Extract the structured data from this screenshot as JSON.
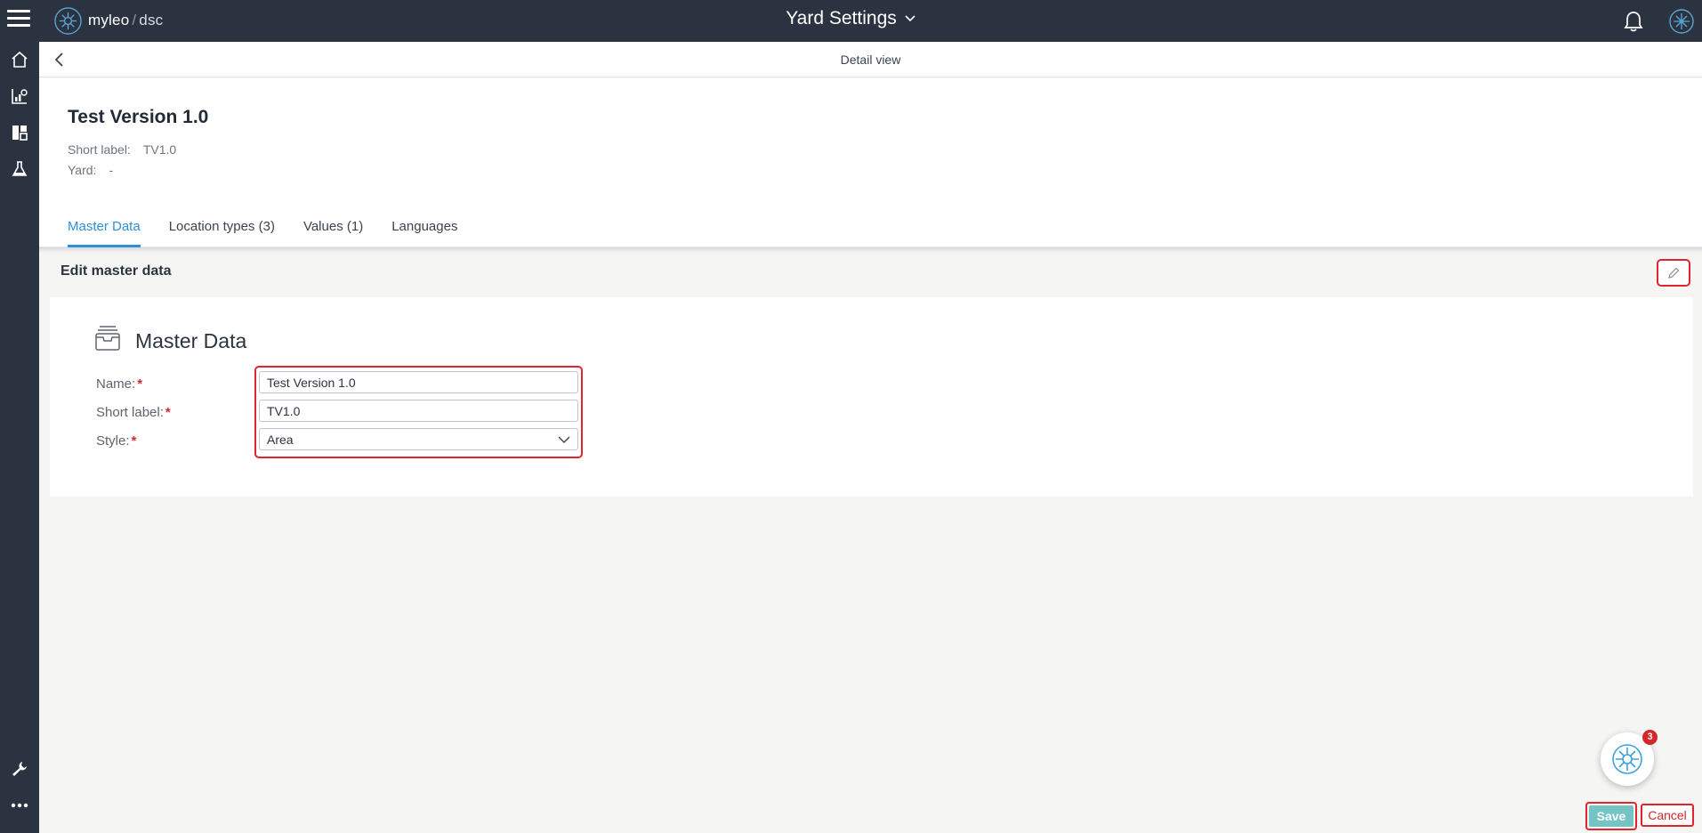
{
  "topbar": {
    "brand": "myleo",
    "brand_sep": "/",
    "brand_product": "dsc",
    "app_title": "Yard Settings",
    "icons": [
      "menu-icon",
      "logo-icon",
      "chevron-down-icon",
      "bell-icon",
      "user-avatar-icon"
    ]
  },
  "sidebar": {
    "items": [
      {
        "name": "home",
        "icon": "home-icon"
      },
      {
        "name": "analytics",
        "icon": "chart-icon"
      },
      {
        "name": "dashboard",
        "icon": "dashboard-icon"
      },
      {
        "name": "lab",
        "icon": "flask-icon"
      },
      {
        "name": "tools",
        "icon": "wrench-icon"
      },
      {
        "name": "more",
        "icon": "more-icon"
      }
    ]
  },
  "subheader": {
    "title": "Detail view"
  },
  "record": {
    "title": "Test Version 1.0",
    "short_label_key": "Short label:",
    "short_label_value": "TV1.0",
    "yard_key": "Yard:",
    "yard_value": "-"
  },
  "tabs": [
    {
      "label": "Master Data",
      "active": true
    },
    {
      "label": "Location types (3)",
      "active": false
    },
    {
      "label": "Values (1)",
      "active": false
    },
    {
      "label": "Languages",
      "active": false
    }
  ],
  "edit": {
    "title": "Edit master data"
  },
  "form": {
    "card_title": "Master Data",
    "name_label": "Name:",
    "short_label_label": "Short label:",
    "style_label": "Style:",
    "required_mark": "*",
    "name_value": "Test Version 1.0",
    "short_label_value": "TV1.0",
    "style_value": "Area"
  },
  "assistant": {
    "badge_count": "3"
  },
  "footer": {
    "save_label": "Save",
    "cancel_label": "Cancel"
  },
  "colors": {
    "topbar_bg": "#2b3240",
    "accent": "#2f8fd8",
    "highlight": "#e1252f",
    "save_bg": "#74c4c6",
    "required": "#d4262c"
  }
}
